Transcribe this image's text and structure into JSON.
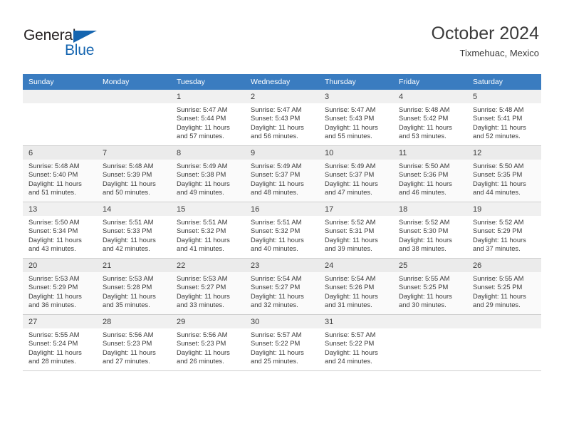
{
  "brand": {
    "name_top": "General",
    "name_bottom": "Blue",
    "accent_color": "#1565b0"
  },
  "header": {
    "title": "October 2024",
    "subtitle": "Tixmehuac, Mexico"
  },
  "calendar": {
    "header_bg": "#3a7cc0",
    "weekdays": [
      "Sunday",
      "Monday",
      "Tuesday",
      "Wednesday",
      "Thursday",
      "Friday",
      "Saturday"
    ],
    "weeks": [
      [
        {
          "day": "",
          "lines": []
        },
        {
          "day": "",
          "lines": []
        },
        {
          "day": "1",
          "lines": [
            "Sunrise: 5:47 AM",
            "Sunset: 5:44 PM",
            "Daylight: 11 hours",
            "and 57 minutes."
          ]
        },
        {
          "day": "2",
          "lines": [
            "Sunrise: 5:47 AM",
            "Sunset: 5:43 PM",
            "Daylight: 11 hours",
            "and 56 minutes."
          ]
        },
        {
          "day": "3",
          "lines": [
            "Sunrise: 5:47 AM",
            "Sunset: 5:43 PM",
            "Daylight: 11 hours",
            "and 55 minutes."
          ]
        },
        {
          "day": "4",
          "lines": [
            "Sunrise: 5:48 AM",
            "Sunset: 5:42 PM",
            "Daylight: 11 hours",
            "and 53 minutes."
          ]
        },
        {
          "day": "5",
          "lines": [
            "Sunrise: 5:48 AM",
            "Sunset: 5:41 PM",
            "Daylight: 11 hours",
            "and 52 minutes."
          ]
        }
      ],
      [
        {
          "day": "6",
          "lines": [
            "Sunrise: 5:48 AM",
            "Sunset: 5:40 PM",
            "Daylight: 11 hours",
            "and 51 minutes."
          ]
        },
        {
          "day": "7",
          "lines": [
            "Sunrise: 5:48 AM",
            "Sunset: 5:39 PM",
            "Daylight: 11 hours",
            "and 50 minutes."
          ]
        },
        {
          "day": "8",
          "lines": [
            "Sunrise: 5:49 AM",
            "Sunset: 5:38 PM",
            "Daylight: 11 hours",
            "and 49 minutes."
          ]
        },
        {
          "day": "9",
          "lines": [
            "Sunrise: 5:49 AM",
            "Sunset: 5:37 PM",
            "Daylight: 11 hours",
            "and 48 minutes."
          ]
        },
        {
          "day": "10",
          "lines": [
            "Sunrise: 5:49 AM",
            "Sunset: 5:37 PM",
            "Daylight: 11 hours",
            "and 47 minutes."
          ]
        },
        {
          "day": "11",
          "lines": [
            "Sunrise: 5:50 AM",
            "Sunset: 5:36 PM",
            "Daylight: 11 hours",
            "and 46 minutes."
          ]
        },
        {
          "day": "12",
          "lines": [
            "Sunrise: 5:50 AM",
            "Sunset: 5:35 PM",
            "Daylight: 11 hours",
            "and 44 minutes."
          ]
        }
      ],
      [
        {
          "day": "13",
          "lines": [
            "Sunrise: 5:50 AM",
            "Sunset: 5:34 PM",
            "Daylight: 11 hours",
            "and 43 minutes."
          ]
        },
        {
          "day": "14",
          "lines": [
            "Sunrise: 5:51 AM",
            "Sunset: 5:33 PM",
            "Daylight: 11 hours",
            "and 42 minutes."
          ]
        },
        {
          "day": "15",
          "lines": [
            "Sunrise: 5:51 AM",
            "Sunset: 5:32 PM",
            "Daylight: 11 hours",
            "and 41 minutes."
          ]
        },
        {
          "day": "16",
          "lines": [
            "Sunrise: 5:51 AM",
            "Sunset: 5:32 PM",
            "Daylight: 11 hours",
            "and 40 minutes."
          ]
        },
        {
          "day": "17",
          "lines": [
            "Sunrise: 5:52 AM",
            "Sunset: 5:31 PM",
            "Daylight: 11 hours",
            "and 39 minutes."
          ]
        },
        {
          "day": "18",
          "lines": [
            "Sunrise: 5:52 AM",
            "Sunset: 5:30 PM",
            "Daylight: 11 hours",
            "and 38 minutes."
          ]
        },
        {
          "day": "19",
          "lines": [
            "Sunrise: 5:52 AM",
            "Sunset: 5:29 PM",
            "Daylight: 11 hours",
            "and 37 minutes."
          ]
        }
      ],
      [
        {
          "day": "20",
          "lines": [
            "Sunrise: 5:53 AM",
            "Sunset: 5:29 PM",
            "Daylight: 11 hours",
            "and 36 minutes."
          ]
        },
        {
          "day": "21",
          "lines": [
            "Sunrise: 5:53 AM",
            "Sunset: 5:28 PM",
            "Daylight: 11 hours",
            "and 35 minutes."
          ]
        },
        {
          "day": "22",
          "lines": [
            "Sunrise: 5:53 AM",
            "Sunset: 5:27 PM",
            "Daylight: 11 hours",
            "and 33 minutes."
          ]
        },
        {
          "day": "23",
          "lines": [
            "Sunrise: 5:54 AM",
            "Sunset: 5:27 PM",
            "Daylight: 11 hours",
            "and 32 minutes."
          ]
        },
        {
          "day": "24",
          "lines": [
            "Sunrise: 5:54 AM",
            "Sunset: 5:26 PM",
            "Daylight: 11 hours",
            "and 31 minutes."
          ]
        },
        {
          "day": "25",
          "lines": [
            "Sunrise: 5:55 AM",
            "Sunset: 5:25 PM",
            "Daylight: 11 hours",
            "and 30 minutes."
          ]
        },
        {
          "day": "26",
          "lines": [
            "Sunrise: 5:55 AM",
            "Sunset: 5:25 PM",
            "Daylight: 11 hours",
            "and 29 minutes."
          ]
        }
      ],
      [
        {
          "day": "27",
          "lines": [
            "Sunrise: 5:55 AM",
            "Sunset: 5:24 PM",
            "Daylight: 11 hours",
            "and 28 minutes."
          ]
        },
        {
          "day": "28",
          "lines": [
            "Sunrise: 5:56 AM",
            "Sunset: 5:23 PM",
            "Daylight: 11 hours",
            "and 27 minutes."
          ]
        },
        {
          "day": "29",
          "lines": [
            "Sunrise: 5:56 AM",
            "Sunset: 5:23 PM",
            "Daylight: 11 hours",
            "and 26 minutes."
          ]
        },
        {
          "day": "30",
          "lines": [
            "Sunrise: 5:57 AM",
            "Sunset: 5:22 PM",
            "Daylight: 11 hours",
            "and 25 minutes."
          ]
        },
        {
          "day": "31",
          "lines": [
            "Sunrise: 5:57 AM",
            "Sunset: 5:22 PM",
            "Daylight: 11 hours",
            "and 24 minutes."
          ]
        },
        {
          "day": "",
          "lines": []
        },
        {
          "day": "",
          "lines": []
        }
      ]
    ]
  }
}
